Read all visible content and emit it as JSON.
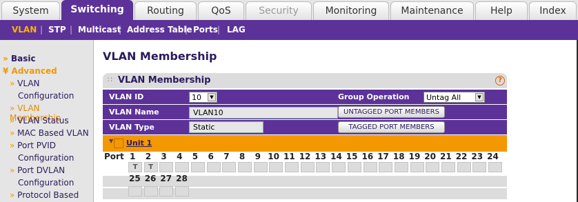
{
  "tabs": [
    {
      "label": "System"
    },
    {
      "label": "Switching"
    },
    {
      "label": "Routing"
    },
    {
      "label": "QoS"
    },
    {
      "label": "Security"
    },
    {
      "label": "Monitoring"
    },
    {
      "label": "Maintenance"
    },
    {
      "label": "Help"
    },
    {
      "label": "Index"
    }
  ],
  "subnav": {
    "items": [
      "VLAN",
      "STP",
      "Multicast",
      "Address Table",
      "Ports",
      "LAG"
    ],
    "separator": "|"
  },
  "sidebar": {
    "basic": "Basic",
    "advanced": "Advanced",
    "items": [
      {
        "label": "VLAN"
      },
      {
        "label": "Configuration"
      },
      {
        "label": "VLAN Membership"
      },
      {
        "label": "VLAN Status"
      },
      {
        "label": "MAC Based VLAN"
      },
      {
        "label": "Port PVID"
      },
      {
        "label": "Configuration"
      },
      {
        "label": "Port DVLAN"
      },
      {
        "label": "Configuration"
      },
      {
        "label": "Protocol Based"
      }
    ]
  },
  "page_title": "VLAN Membership",
  "panel": {
    "title": "VLAN Membership",
    "help": "?",
    "vlan_id_label": "VLAN ID",
    "vlan_id_value": "10",
    "group_operation_label": "Group Operation",
    "group_operation_value": "Untag All",
    "vlan_name_label": "VLAN Name",
    "vlan_name_value": "VLAN10",
    "vlan_type_label": "VLAN Type",
    "vlan_type_value": "Static",
    "untagged_button": "UNTAGGED PORT MEMBERS",
    "tagged_button": "TAGGED PORT MEMBERS",
    "unit_label": "Unit 1",
    "port_label": "Port",
    "ports_row1": [
      "1",
      "2",
      "3",
      "4",
      "5",
      "6",
      "7",
      "8",
      "9",
      "10",
      "11",
      "12",
      "13",
      "14",
      "15",
      "16",
      "17",
      "18",
      "19",
      "20",
      "21",
      "22",
      "23",
      "24"
    ],
    "ports_row2": [
      "25",
      "26",
      "27",
      "28"
    ],
    "row1_values": [
      "T",
      "T",
      "",
      "",
      "",
      "",
      "",
      "",
      "",
      "",
      "",
      "",
      "",
      "",
      "",
      "",
      "",
      "",
      "",
      "",
      "",
      "",
      "",
      ""
    ],
    "row2_values": [
      "",
      "",
      "",
      ""
    ]
  },
  "colors": {
    "accent": "#5c3299",
    "highlight": "#f39800",
    "active_text": "#ffb400"
  }
}
